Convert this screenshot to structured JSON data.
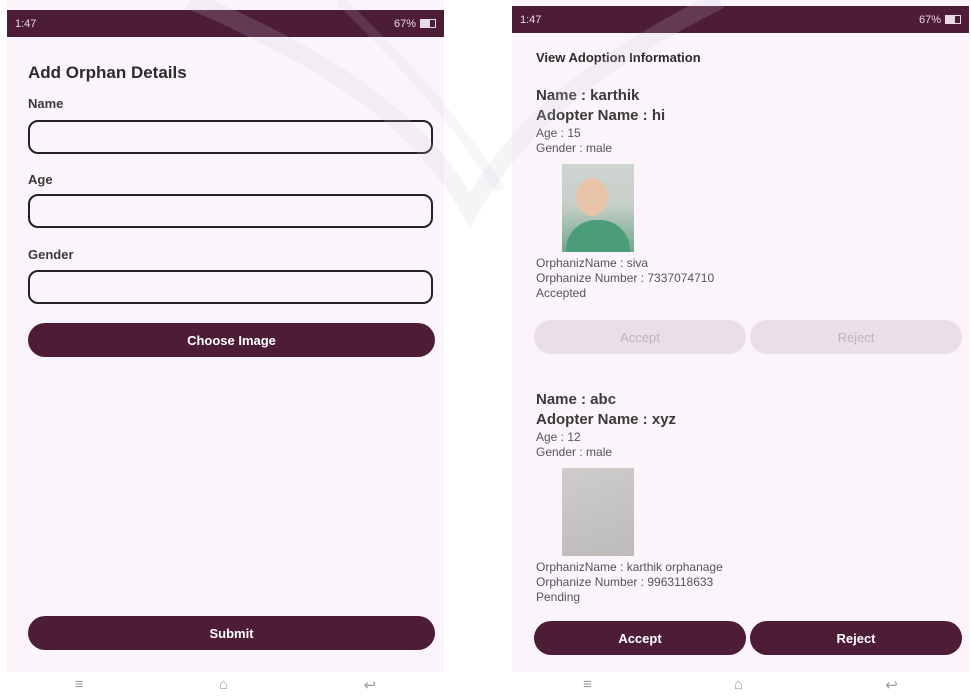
{
  "left_screen": {
    "status": {
      "time": "1:47",
      "battery": "67%"
    },
    "title": "Add Orphan Details",
    "fields": {
      "name_label": "Name",
      "age_label": "Age",
      "gender_label": "Gender"
    },
    "choose_image_label": "Choose Image",
    "submit_label": "Submit",
    "nav": {
      "menu": "≡",
      "home": "⌂",
      "back": "↩"
    }
  },
  "right_screen": {
    "status": {
      "time": "1:47",
      "battery": "67%"
    },
    "title": "View Adoption Information",
    "cards": [
      {
        "name": "Name : karthik",
        "adopter": "Adopter Name : hi",
        "age": "Age : 15",
        "gender": "Gender : male",
        "org_name": "OrphanizName : siva",
        "org_number": "Orphanize Number : 7337074710",
        "status": "Accepted",
        "accept_label": "Accept",
        "reject_label": "Reject"
      },
      {
        "name": "Name : abc",
        "adopter": "Adopter Name : xyz",
        "age": "Age : 12",
        "gender": "Gender : male",
        "org_name": "OrphanizName : karthik orphanage",
        "org_number": "Orphanize Number : 9963118633",
        "status": "Pending",
        "accept_label": "Accept",
        "reject_label": "Reject"
      }
    ],
    "nav": {
      "menu": "≡",
      "home": "⌂",
      "back": "↩"
    }
  },
  "colors": {
    "primary": "#4d1c36",
    "background": "#fcf4fb",
    "disabled": "#ebdfe7"
  }
}
